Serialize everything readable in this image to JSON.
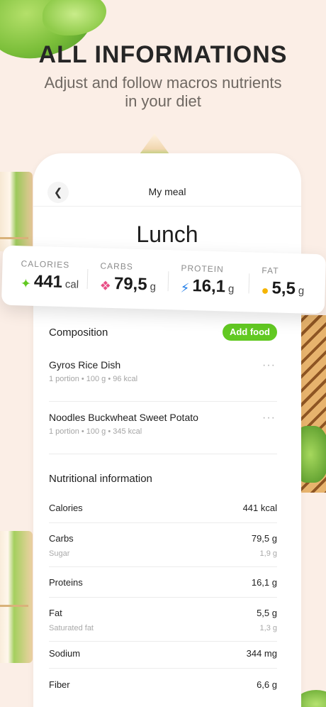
{
  "header": {
    "headline": "ALL INFORMATIONS",
    "subline": "Adjust and follow macros nutrients in your diet"
  },
  "nav": {
    "back_icon": "chevron-left-icon",
    "title": "My meal"
  },
  "meal": {
    "title": "Lunch"
  },
  "macros": [
    {
      "label": "CALORIES",
      "value": "441",
      "unit": "cal",
      "icon": "flame-icon",
      "color": "#62c922"
    },
    {
      "label": "CARBS",
      "value": "79,5",
      "unit": "g",
      "icon": "wheat-icon",
      "color": "#e84f86"
    },
    {
      "label": "PROTEIN",
      "value": "16,1",
      "unit": "g",
      "icon": "lightning-icon",
      "color": "#1e7ce8"
    },
    {
      "label": "FAT",
      "value": "5,5",
      "unit": "g",
      "icon": "drop-icon",
      "color": "#f5b400"
    }
  ],
  "composition": {
    "title": "Composition",
    "add_label": "Add food",
    "items": [
      {
        "name": "Gyros Rice Dish",
        "meta": "1 portion • 100 g • 96 kcal"
      },
      {
        "name": "Noodles Buckwheat Sweet Potato",
        "meta": "1 portion • 100 g • 345 kcal"
      }
    ]
  },
  "nutrition": {
    "title": "Nutritional information",
    "rows": [
      {
        "name": "Calories",
        "value": "441 kcal"
      },
      {
        "name": "Carbs",
        "value": "79,5 g",
        "sub_name": "Sugar",
        "sub_value": "1,9 g"
      },
      {
        "name": "Proteins",
        "value": "16,1 g"
      },
      {
        "name": "Fat",
        "value": "5,5 g",
        "sub_name": "Saturated fat",
        "sub_value": "1,3 g"
      },
      {
        "name": "Sodium",
        "value": "344 mg"
      },
      {
        "name": "Fiber",
        "value": "6,6 g"
      }
    ]
  },
  "colors": {
    "background": "#fbeee6",
    "accent_green": "#62c922"
  }
}
